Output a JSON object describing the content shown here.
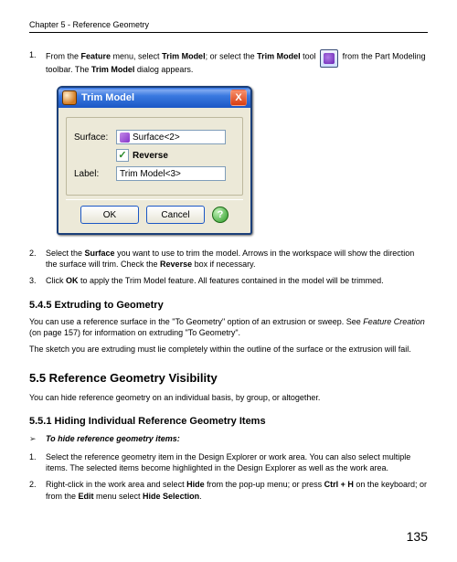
{
  "header": "Chapter 5 - Reference Geometry",
  "step1": {
    "n": "1.",
    "pre": "From the ",
    "b1": "Feature",
    "mid1": " menu, select ",
    "b2": "Trim Model",
    "mid2": "; or select the ",
    "b3": "Trim Model",
    "mid3": " tool ",
    "post1": " from the Part Modeling toolbar. The ",
    "b4": "Trim Model",
    "post2": " dialog appears."
  },
  "dialog": {
    "title": "Trim Model",
    "close": "X",
    "surface_label": "Surface:",
    "surface_value": "Surface<2>",
    "reverse_checked": "✓",
    "reverse_label": "Reverse",
    "label_label": "Label:",
    "label_value": "Trim Model<3>",
    "ok": "OK",
    "cancel": "Cancel",
    "help": "?"
  },
  "step2": {
    "n": "2.",
    "pre": "Select the ",
    "b1": "Surface",
    "mid": " you want to use to trim the model. Arrows in the workspace will show the direction the surface will trim. Check the ",
    "b2": "Reverse",
    "post": " box if necessary."
  },
  "step3": {
    "n": "3.",
    "pre": "Click ",
    "b1": "OK",
    "post": " to apply the Trim Model feature. All features contained in the model will be trimmed."
  },
  "sec545": "5.4.5    Extruding to Geometry",
  "p545a_pre": "You can use a reference surface in the \"To Geometry\" option of an extrusion or sweep. See ",
  "p545a_it": "Feature Creation",
  "p545a_post": " (on page 157) for information on extruding \"To Geometry\".",
  "p545b": "The sketch you are extruding must lie completely within the outline of the surface or the extrusion will fail.",
  "sec55": "5.5    Reference Geometry Visibility",
  "p55": "You can hide reference geometry on an individual basis, by group, or altogether.",
  "sec551": "5.5.1    Hiding Individual Reference Geometry Items",
  "bullet_mark": "➢",
  "bullet_text": "To hide reference geometry items:",
  "h1": {
    "n": "1.",
    "text": "Select the reference geometry item in the Design Explorer or work area. You can also select multiple items. The selected items become highlighted in the Design Explorer as well as the work area."
  },
  "h2": {
    "n": "2.",
    "pre": "Right-click in the work area and select ",
    "b1": "Hide",
    "mid1": " from the pop-up menu; or press ",
    "b2": "Ctrl + H",
    "mid2": " on the keyboard; or from the ",
    "b3": "Edit",
    "mid3": " menu select ",
    "b4": "Hide Selection",
    "post": "."
  },
  "page_number": "135"
}
